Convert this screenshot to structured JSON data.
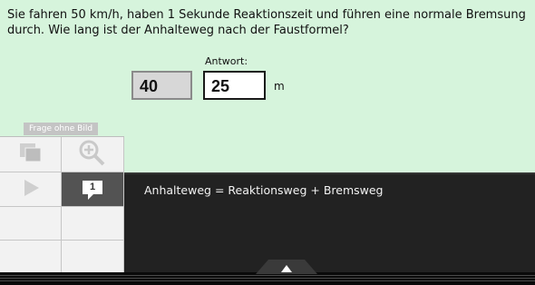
{
  "question": {
    "text": "Sie fahren 50 km/h, haben 1 Sekunde Reaktionszeit und führen eine normale Bremsung durch. Wie lang ist der Anhalteweg nach der Faustformel?"
  },
  "answer": {
    "label": "Antwort:",
    "given_value": "40",
    "entered_value": "25",
    "unit": "m"
  },
  "sidebar": {
    "no_image_label": "Frage ohne Bild",
    "hint_badge": "1",
    "icons": [
      "copy-icon",
      "zoom-in-icon",
      "play-icon",
      "hint-bubble-icon"
    ]
  },
  "hint": {
    "text": "Anhalteweg = Reaktionsweg + Bremsweg"
  },
  "colors": {
    "background": "#d6f4dc",
    "panel": "#222222",
    "active_cell": "#535353"
  }
}
